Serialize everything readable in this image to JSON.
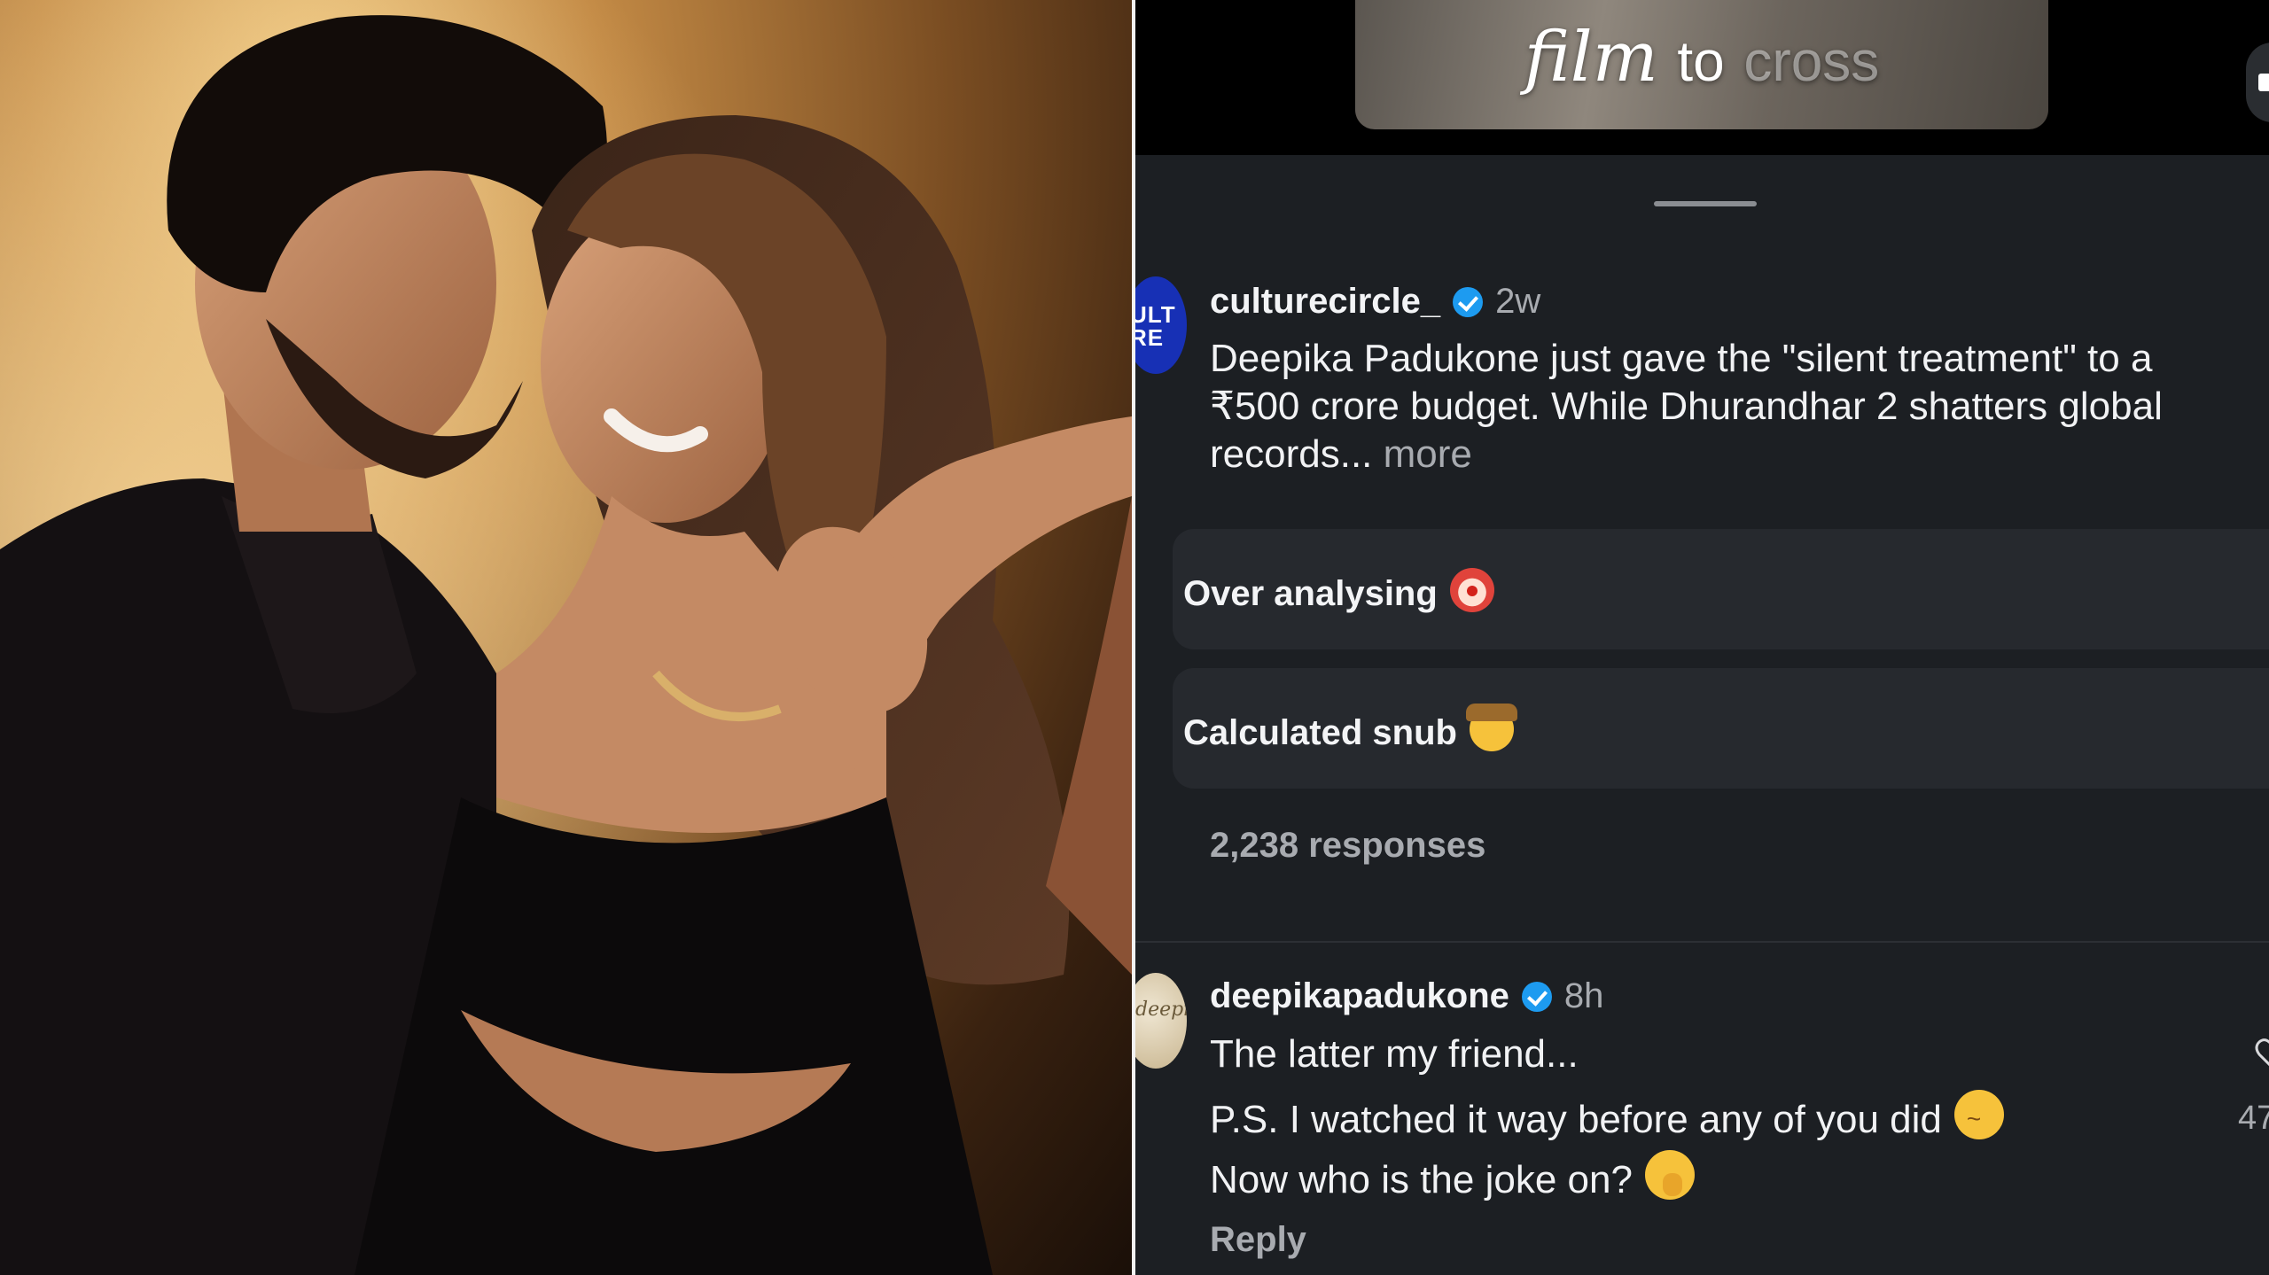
{
  "video": {
    "caption_word1": "film",
    "caption_word2": "to",
    "caption_word3": "cross"
  },
  "post": {
    "avatar_text": "ULT\nRE",
    "username": "culturecircle_",
    "time": "2w",
    "line1": "Deepika Padukone just gave the \"silent treatment\" to a",
    "line2": "₹500 crore budget. While Dhurandhar 2 shatters global",
    "line3": "records...",
    "more_label": "more"
  },
  "poll": {
    "options": [
      {
        "label": "Over analysing",
        "emoji": "clown-face-icon"
      },
      {
        "label": "Calculated snub",
        "emoji": "cowboy-hat-face-icon"
      }
    ],
    "responses": "2,238 responses"
  },
  "comment": {
    "avatar_text": "deepika",
    "username": "deepikapadukone",
    "time": "8h",
    "line1": "The latter my friend...",
    "line2": "P.S. I watched it way before any of you did",
    "line3": "Now who is the joke on?",
    "reply_label": "Reply",
    "like_count": "47",
    "emoji_wink": "winking-face-icon",
    "emoji_hand": "face-with-hand-over-mouth-icon"
  },
  "colors": {
    "panel_bg": "#1c1f23",
    "option_bg": "#26292e",
    "verified": "#1d9bf0",
    "muted": "#a8abb0"
  }
}
